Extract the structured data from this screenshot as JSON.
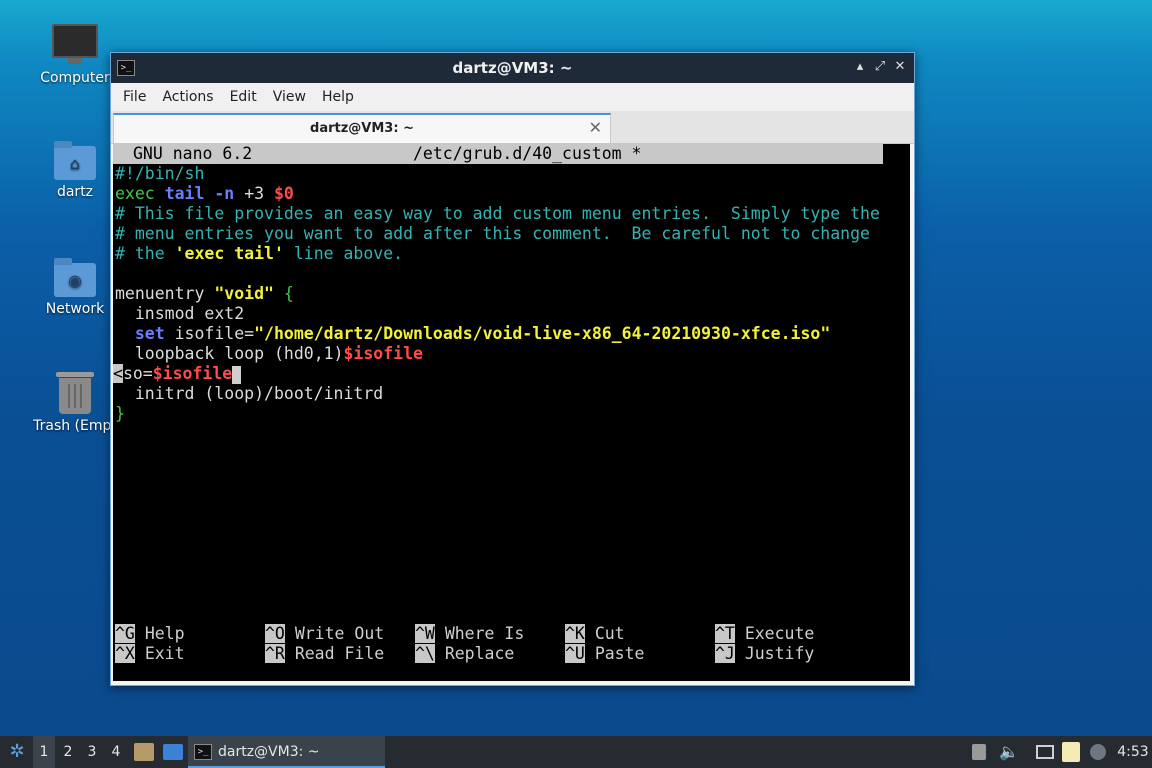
{
  "desktop": {
    "icons": [
      {
        "label": "Computer",
        "icon": "computer-icon"
      },
      {
        "label": "dartz",
        "icon": "home-folder-icon"
      },
      {
        "label": "Network",
        "icon": "network-folder-icon"
      },
      {
        "label": "Trash (Empt",
        "icon": "trash-icon"
      }
    ]
  },
  "window": {
    "title": "dartz@VM3: ~",
    "controls": {
      "minimize": "▴",
      "maximize": "⤢",
      "close": "✕"
    },
    "menu": [
      "File",
      "Actions",
      "Edit",
      "View",
      "Help"
    ],
    "tab": {
      "label": "dartz@VM3: ~",
      "close": "✕"
    }
  },
  "nano": {
    "version": "GNU nano 6.2",
    "file": "/etc/grub.d/40_custom *",
    "lines": {
      "l1": "#!/bin/sh",
      "l2_cmd": "exec",
      "l2_tail": "tail",
      "l2_flag": "-n",
      "l2_num": "+3",
      "l2_var": "$0",
      "l3": "# This file provides an easy way to add custom menu entries.  Simply type the",
      "l4": "# menu entries you want to add after this comment.  Be careful not to change",
      "l5_a": "# the ",
      "l5_b": "'exec tail'",
      "l5_c": " line above.",
      "l7_a": "menuentry ",
      "l7_b": "\"void\"",
      "l7_c": " {",
      "l8": "  insmod ext2",
      "l9_set": "set",
      "l9_a": " isofile=",
      "l9_b": "\"/home/dartz/Downloads/void-live-x86_64-20210930-xfce.iso\"",
      "l10_a": "  loopback loop ",
      "l10_b": "(hd0,1)",
      "l10_c": "$isofile",
      "l11_a": "<",
      "l11_b": "so=",
      "l11_c": "$isofile",
      "l12_a": "  initrd ",
      "l12_b": "(loop)",
      "l12_c": "/boot/initrd",
      "l13": "}"
    },
    "shortcuts": [
      {
        "key": "^G",
        "label": "Help"
      },
      {
        "key": "^O",
        "label": "Write Out"
      },
      {
        "key": "^W",
        "label": "Where Is"
      },
      {
        "key": "^K",
        "label": "Cut"
      },
      {
        "key": "^T",
        "label": "Execute"
      },
      {
        "key": "^X",
        "label": "Exit"
      },
      {
        "key": "^R",
        "label": "Read File"
      },
      {
        "key": "^\\",
        "label": "Replace"
      },
      {
        "key": "^U",
        "label": "Paste"
      },
      {
        "key": "^J",
        "label": "Justify"
      }
    ]
  },
  "taskbar": {
    "workspaces": [
      "1",
      "2",
      "3",
      "4"
    ],
    "task_label": "dartz@VM3: ~",
    "clock": "4:53"
  },
  "colors": {
    "comment": "#34b3b3",
    "keyword_green": "#44c844",
    "keyword_blue": "#6b7dff",
    "variable_red": "#ff4b4b",
    "string_yellow": "#f2f23a",
    "accent": "#4a90d9"
  }
}
